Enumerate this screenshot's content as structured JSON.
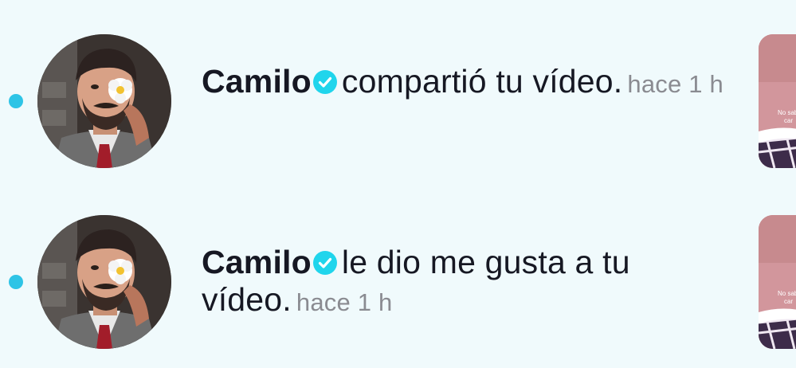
{
  "notifications": [
    {
      "username": "Camilo",
      "verified": true,
      "action": "compartió tu vídeo.",
      "time": "hace 1 h",
      "thumbnail_caption_line1": "No sab",
      "thumbnail_caption_line2": "car"
    },
    {
      "username": "Camilo",
      "verified": true,
      "action": "le dio me gusta a tu vídeo.",
      "time": "hace 1 h",
      "thumbnail_caption_line1": "No sab",
      "thumbnail_caption_line2": "car"
    }
  ],
  "colors": {
    "background": "#f0fafc",
    "unread_dot": "#2ec4e6",
    "verified_badge": "#20d5ec",
    "text_primary": "#161823",
    "text_secondary": "#8a8b91"
  },
  "icons": {
    "verified": "verified-badge-icon"
  }
}
